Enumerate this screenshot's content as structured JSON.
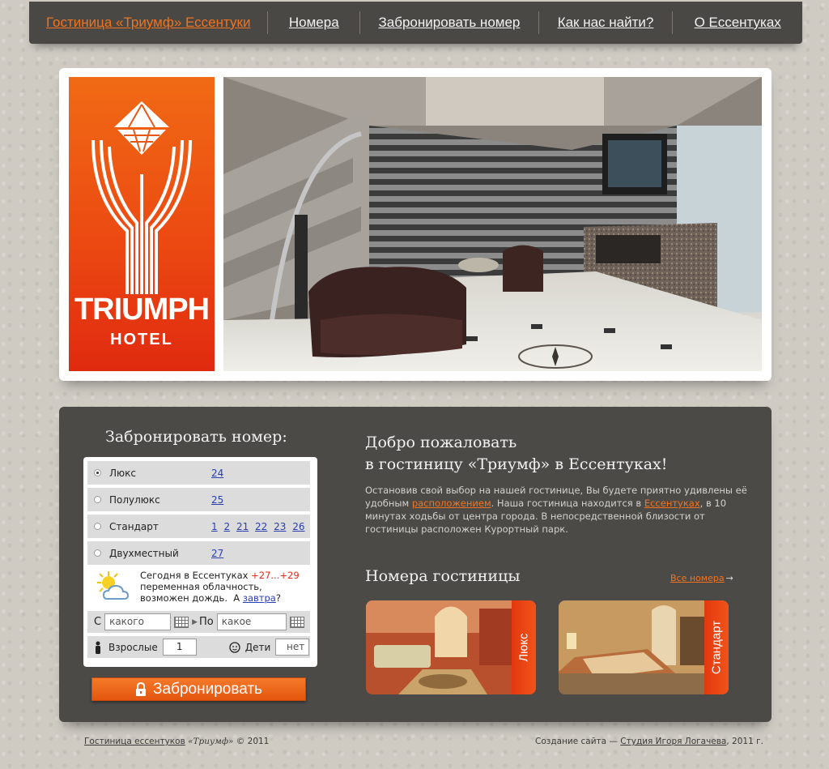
{
  "nav": {
    "brand": "Гостиница «Триумф» Ессентуки",
    "items": [
      "Номера",
      "Забронировать номер",
      "Как нас найти?",
      "О Ессентуках"
    ]
  },
  "logo": {
    "word1": "TRIUMPH",
    "word2": "HOTEL"
  },
  "booking": {
    "title": "Забронировать номер:",
    "room_types": [
      {
        "label": "Люкс",
        "numbers": [
          "24"
        ],
        "selected": true
      },
      {
        "label": "Полулюкс",
        "numbers": [
          "25"
        ],
        "selected": false
      },
      {
        "label": "Стандарт",
        "numbers": [
          "1",
          "2",
          "21",
          "22",
          "23",
          "26"
        ],
        "selected": false
      },
      {
        "label": "Двухместный",
        "numbers": [
          "27"
        ],
        "selected": false
      }
    ],
    "weather": {
      "line1": "Сегодня в Ессентуках",
      "temp": "+27...+29",
      "line2": "переменная облачность,",
      "line3": "возможен дождь.",
      "a_word": "А",
      "tomorrow": "завтра",
      "q": "?",
      "icon": "partly-cloudy-icon"
    },
    "from_label": "С",
    "from_placeholder": "какого",
    "to_label": "По",
    "to_placeholder": "какое",
    "adults_label": "Взрослые",
    "adults_value": "1",
    "children_label": "Дети",
    "children_value": "нет",
    "button": "Забронировать"
  },
  "welcome": {
    "line1": "Добро пожаловать",
    "line2": "в гостиницу «Триумф» в Ессентуках!",
    "p1": "Остановив свой выбор на нашей гостинице, Вы будете приятно удивлены её удобным ",
    "link1": "расположением",
    "p2": ". Наша гостиница находится в ",
    "link2": "Ессентуках",
    "p3": ", в 10 минутах ходьбы от центра города. В непосредственной близости от гостиницы расположен Курортный парк."
  },
  "rooms": {
    "title": "Номера гостиницы",
    "all_link": "Все номера",
    "all_arrow": "→",
    "cards": [
      "Люкс",
      "Стандарт"
    ]
  },
  "footer": {
    "left_link": "Гостиница ессентуков",
    "left_name": "«Триумф»",
    "left_tail": " © 2011",
    "right_pre": "Создание сайта — ",
    "right_link": "Студия Игоря Логачева",
    "right_tail": ", 2011 г."
  },
  "colors": {
    "accent": "#f2731e",
    "panel": "#4b4a47",
    "nav": "#4a4845"
  }
}
